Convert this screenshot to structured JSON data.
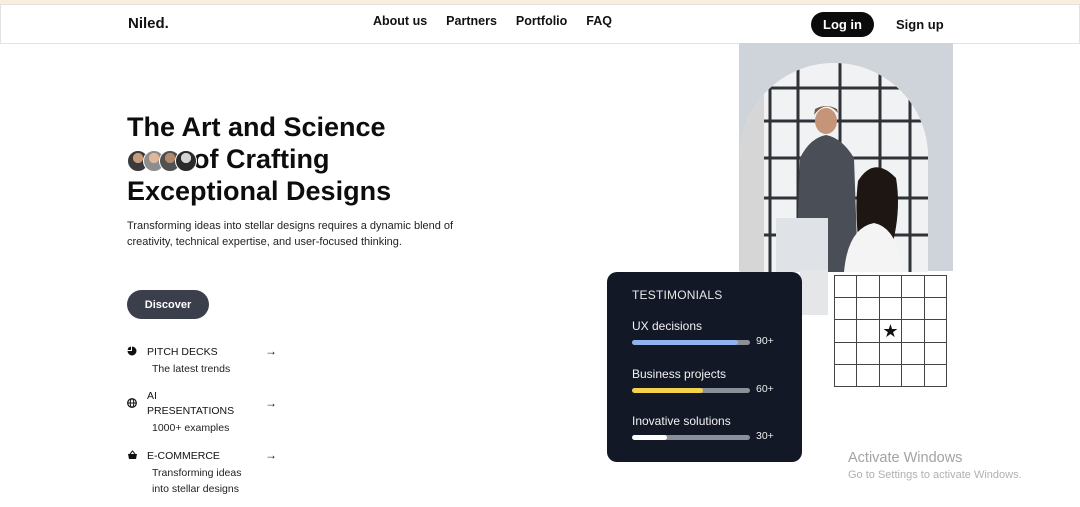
{
  "nav": {
    "logo": "Niled.",
    "links": [
      "About us",
      "Partners",
      "Portfolio",
      "FAQ"
    ],
    "login": "Log in",
    "signup": "Sign up"
  },
  "hero": {
    "title_line1": "The Art and Science",
    "title_line2": "of Crafting",
    "title_line3": "Exceptional Designs",
    "subtitle": "Transforming ideas into stellar designs requires a dynamic blend of creativity, technical expertise, and user-focused thinking.",
    "cta": "Discover"
  },
  "features": [
    {
      "icon": "pie-chart-icon",
      "title": "PITCH DECKS",
      "desc": "The latest trends"
    },
    {
      "icon": "globe-icon",
      "title": "AI PRESENTATIONS",
      "desc": "1000+ examples"
    },
    {
      "icon": "basket-icon",
      "title": "E-COMMERCE",
      "desc": "Transforming ideas into stellar designs"
    }
  ],
  "testimonials": {
    "title": "TESTIMONIALS",
    "metrics": [
      {
        "label": "UX decisions",
        "value": "90+",
        "fill": 0.9,
        "color": "#8fb3ef"
      },
      {
        "label": "Business projects",
        "value": "60+",
        "fill": 0.6,
        "color": "#f3d34a"
      },
      {
        "label": "Inovative solutions",
        "value": "30+",
        "fill": 0.3,
        "color": "#ffffff"
      }
    ]
  },
  "grid": {
    "rows": 5,
    "cols": 5,
    "star": "★"
  },
  "watermark": {
    "title": "Activate Windows",
    "subtitle": "Go to Settings to activate Windows."
  }
}
